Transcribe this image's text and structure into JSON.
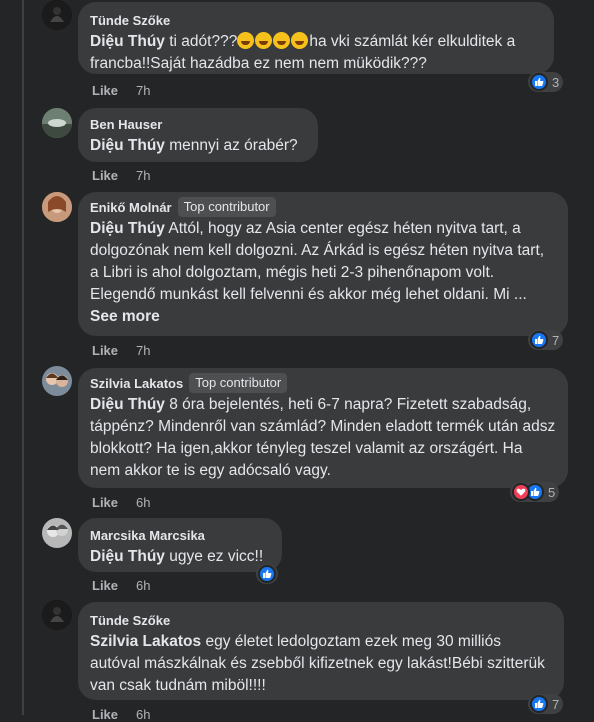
{
  "comments": [
    {
      "author": "Tünde Szőke",
      "badge": "",
      "mention": "Diệu Thúy",
      "text_before_emoji": " ti adót???",
      "emojis": [
        "laugh",
        "laugh",
        "laugh",
        "laugh"
      ],
      "text_line1_end": "ha vki számlát kér elkulditek a",
      "text_rest": "francba!!Saját hazádba ez nem nem müködik???",
      "like_label": "Like",
      "time": "7h",
      "reactions": [
        "like"
      ],
      "reaction_count": "3"
    },
    {
      "author": "Ben Hauser",
      "badge": "",
      "mention": "Diệu Thúy",
      "text": " mennyi az órabér?",
      "like_label": "Like",
      "time": "7h"
    },
    {
      "author": "Enikő Molnár",
      "badge": "Top contributor",
      "mention": "Diệu Thúy",
      "text": " Attól, hogy az Asia center egész héten nyitva tart, a dolgozónak nem kell dolgozni. Az Árkád is egész héten nyitva tart, a Libri is ahol dolgoztam, mégis heti 2-3 pihenőnapom volt. Elegendő munkást kell felvenni és akkor még lehet oldani. Mi ... ",
      "see_more": "See more",
      "like_label": "Like",
      "time": "7h",
      "reactions": [
        "like"
      ],
      "reaction_count": "7"
    },
    {
      "author": "Szilvia Lakatos",
      "badge": "Top contributor",
      "mention": "Diệu Thúy",
      "text": " 8 óra bejelentés, heti 6-7 napra? Fizetett szabadság, táppénz? Mindenről van számlád? Minden eladott termék után adsz blokkott? Ha igen,akkor tényleg teszel valamit az országért. Ha nem akkor te is egy adócsaló vagy.",
      "like_label": "Like",
      "time": "6h",
      "reactions": [
        "love",
        "like"
      ],
      "reaction_count": "5"
    },
    {
      "author": "Marcsika Marcsika",
      "badge": "",
      "mention": "Diệu Thúy",
      "text": " ugye ez vicc!!",
      "like_label": "Like",
      "time": "6h",
      "reactions": [
        "like"
      ],
      "reaction_count": ""
    },
    {
      "author": "Tünde Szőke",
      "badge": "",
      "mention": "Szilvia Lakatos",
      "text": " egy életet ledolgoztam ezek meg 30 milliós autóval mászkálnak és zsebből kifizetnek egy lakást!Bébi szitterük van csak tudnám miböl!!!!",
      "like_label": "Like",
      "time": "6h",
      "reactions": [
        "like"
      ],
      "reaction_count": "7"
    }
  ],
  "colors": {
    "background": "#242526",
    "bubble": "#3a3b3c",
    "text": "#e4e6eb",
    "secondary_text": "#b0b3b8",
    "like_blue": "#1877f2",
    "love_red": "#f33e58"
  },
  "icons": {
    "like_reaction": "thumbs-up-icon",
    "love_reaction": "heart-icon",
    "laugh_emoji": "rolling-laughing-emoji"
  }
}
